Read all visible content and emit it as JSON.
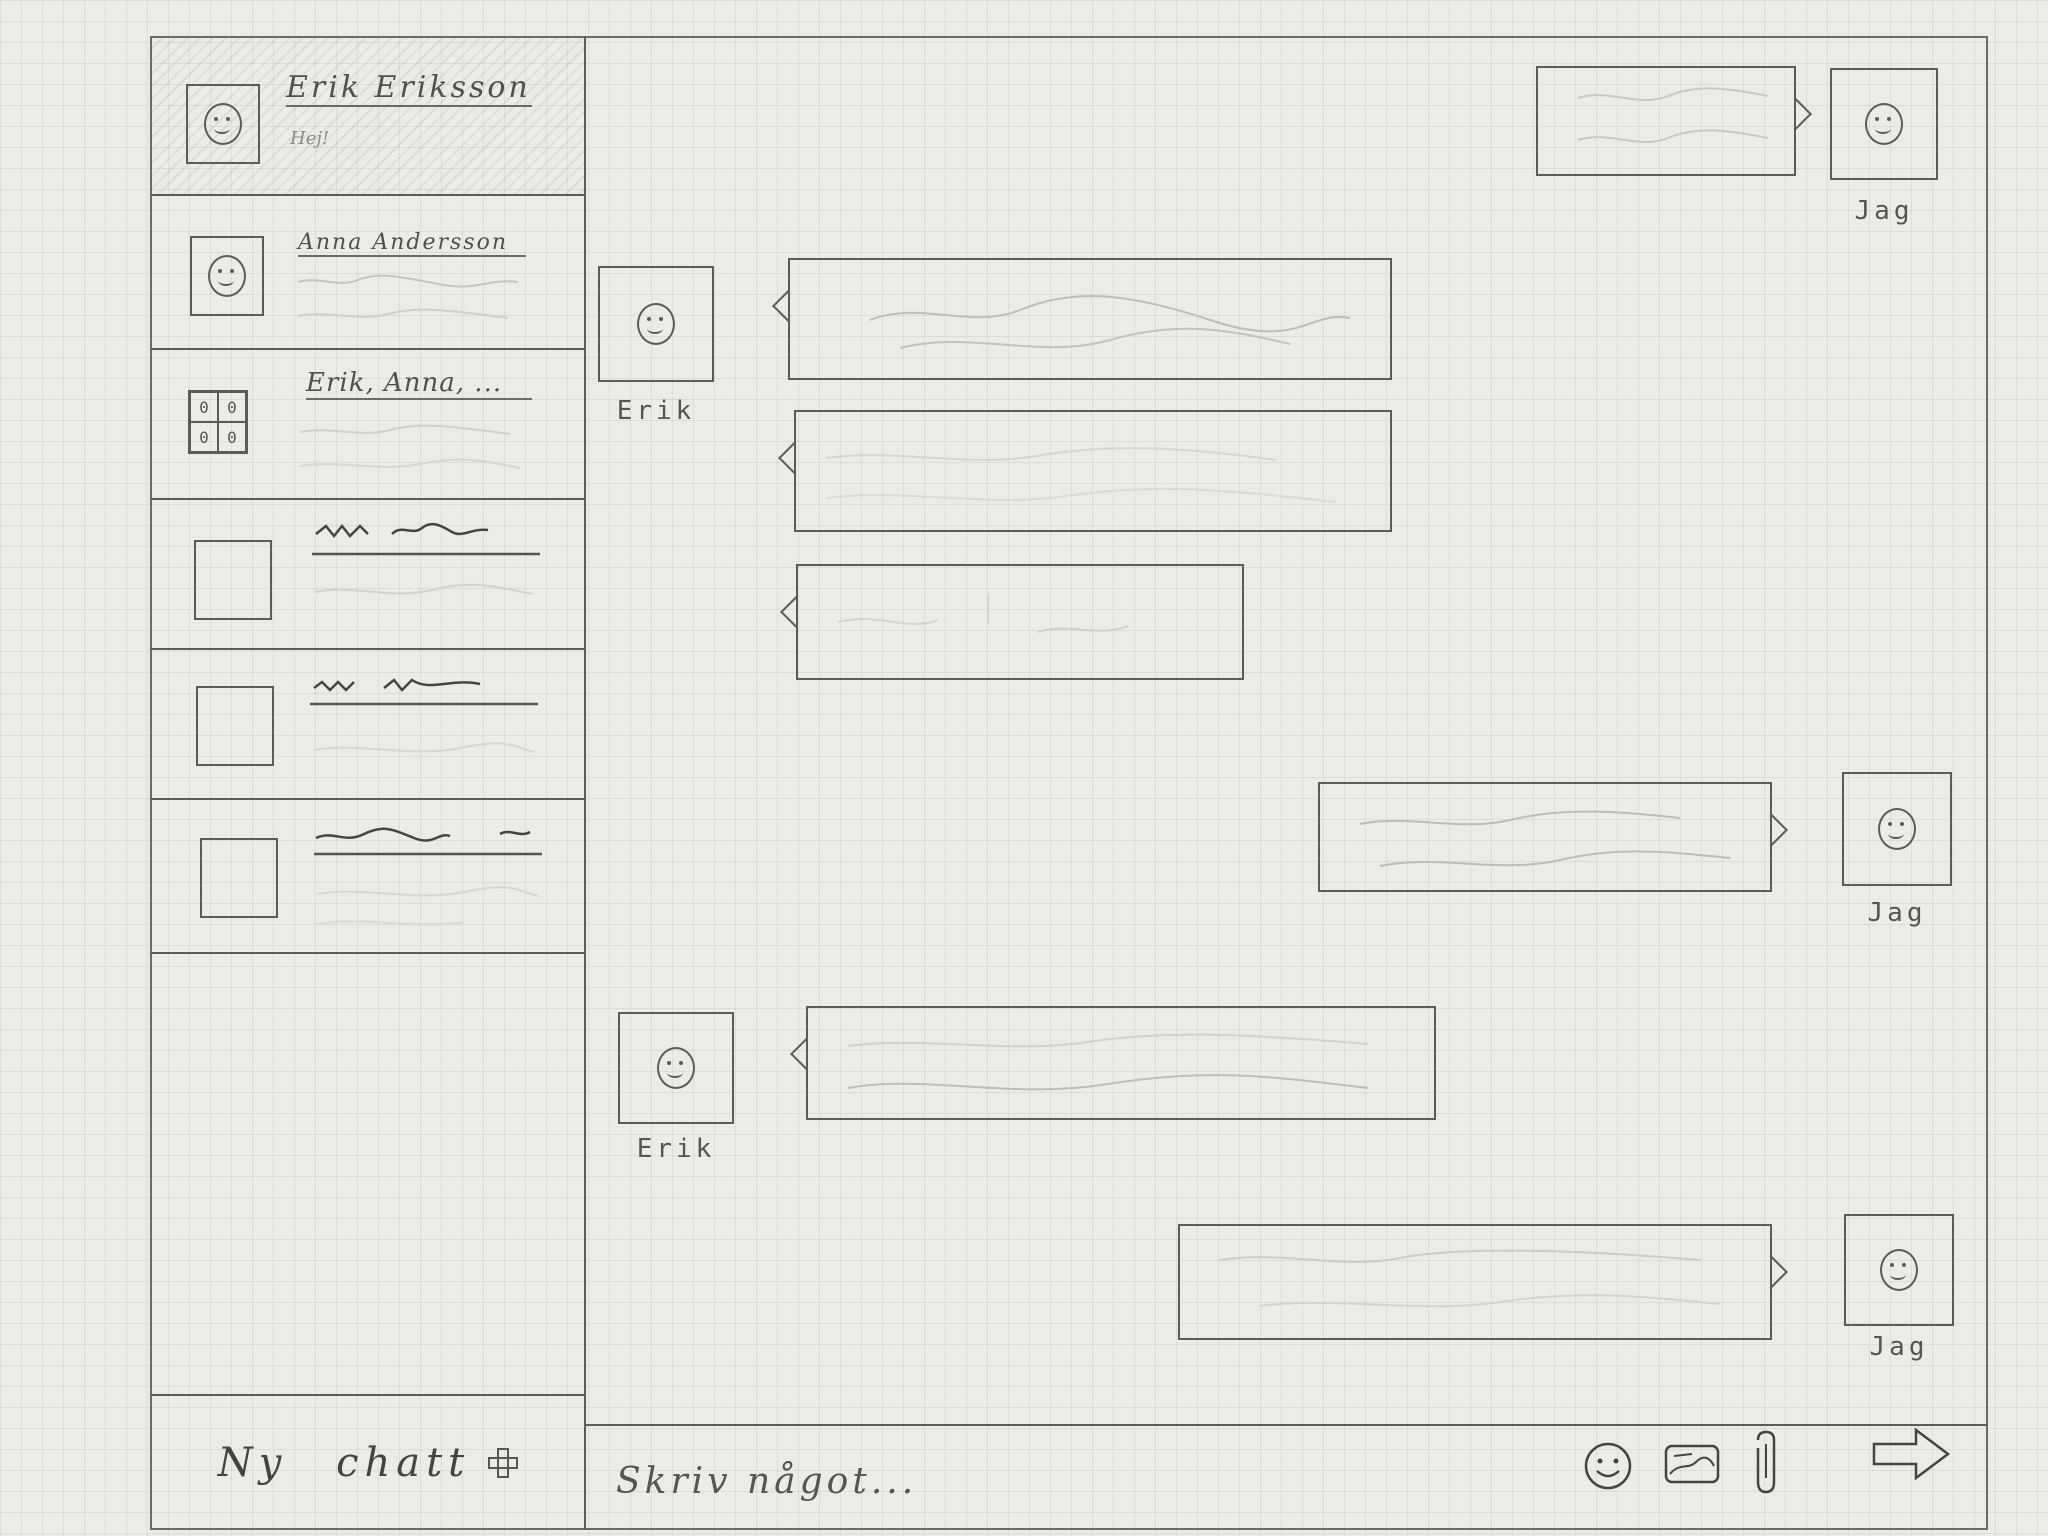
{
  "sidebar": {
    "chats": [
      {
        "name": "Erik Eriksson",
        "preview": "Hej!",
        "avatar": "smiley-icon"
      },
      {
        "name": "Anna Andersson",
        "preview": "",
        "avatar": "smiley-icon"
      },
      {
        "name": "Erik, Anna, ...",
        "preview": "",
        "avatar": "group-icon"
      },
      {
        "name": "",
        "preview": "",
        "avatar": "empty"
      },
      {
        "name": "",
        "preview": "",
        "avatar": "empty"
      },
      {
        "name": "",
        "preview": "",
        "avatar": "empty"
      }
    ],
    "new_chat_label": "Ny chatt"
  },
  "conversation": {
    "messages": [
      {
        "sender": "Jag",
        "side": "right"
      },
      {
        "sender": "Erik",
        "side": "left"
      },
      {
        "sender": "",
        "side": "left"
      },
      {
        "sender": "",
        "side": "left"
      },
      {
        "sender": "Jag",
        "side": "right"
      },
      {
        "sender": "Erik",
        "side": "left"
      },
      {
        "sender": "Jag",
        "side": "right"
      }
    ]
  },
  "composer": {
    "placeholder": "Skriv något...",
    "icons": [
      "emoji-icon",
      "image-icon",
      "attachment-icon",
      "send-arrow-icon"
    ]
  }
}
